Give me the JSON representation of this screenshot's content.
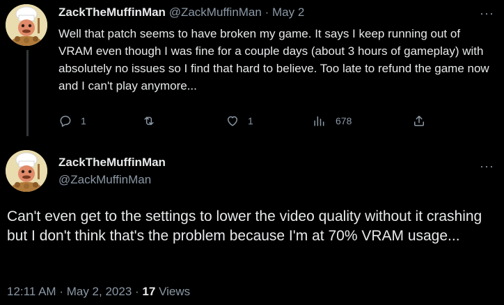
{
  "tweet1": {
    "display_name": "ZackTheMuffinMan",
    "handle": "@ZackMuffinMan",
    "separator": "·",
    "date": "May 2",
    "more": "···",
    "text": "Well that patch seems to have broken my game. It says I keep running out of VRAM even though I was fine for a couple days (about 3 hours of gameplay) with absolutely no issues so I find that hard to believe. Too late to refund the game now and I can't play anymore...",
    "actions": {
      "reply_icon": "reply-icon",
      "replies": "1",
      "retweet_icon": "retweet-icon",
      "like_icon": "like-icon",
      "likes": "1",
      "views_icon": "views-icon",
      "views": "678",
      "share_icon": "share-icon"
    }
  },
  "tweet2": {
    "display_name": "ZackTheMuffinMan",
    "handle": "@ZackMuffinMan",
    "more": "···",
    "text": "Can't even get to the settings to lower the video quality without it crashing but I don't think that's the problem because I'm at 70% VRAM usage...",
    "time": "12:11 AM",
    "sep1": "·",
    "date": "May 2, 2023",
    "sep2": "·",
    "views_count": "17",
    "views_label": "Views"
  },
  "colors": {
    "background": "#000000",
    "text": "#e7e9ea",
    "secondary": "#8b98a5",
    "thread_line": "#333639"
  }
}
